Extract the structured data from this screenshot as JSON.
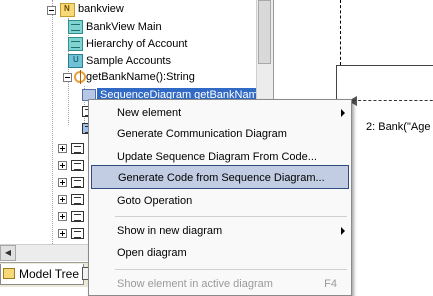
{
  "tree": {
    "nodes": {
      "bankview": "bankview",
      "bankview_main": "BankView Main",
      "hierarchy": "Hierarchy of Account",
      "sample_accounts": "Sample Accounts",
      "get_bank_name": "getBankName():String",
      "sequence_diagram": "SequenceDiagram getBankName"
    }
  },
  "tabs": {
    "model_tree": "Model Tree"
  },
  "diagram": {
    "message_label": "2: Bank(\"Age"
  },
  "context_menu": {
    "items": [
      {
        "label": "New element",
        "submenu": true
      },
      {
        "label": "Generate Communication Diagram"
      },
      {
        "label": "Update Sequence Diagram From Code..."
      },
      {
        "label": "Generate Code from Sequence Diagram..."
      },
      {
        "label": "Goto Operation"
      },
      {
        "label": "Show in new diagram",
        "submenu": true
      },
      {
        "label": "Open diagram"
      },
      {
        "label": "Show element in active diagram",
        "shortcut": "F4"
      }
    ],
    "highlighted_index": 3
  },
  "colors": {
    "selection": "#316ac5",
    "menu_highlight": "#c2cde4",
    "menu_highlight_border": "#314c80"
  }
}
